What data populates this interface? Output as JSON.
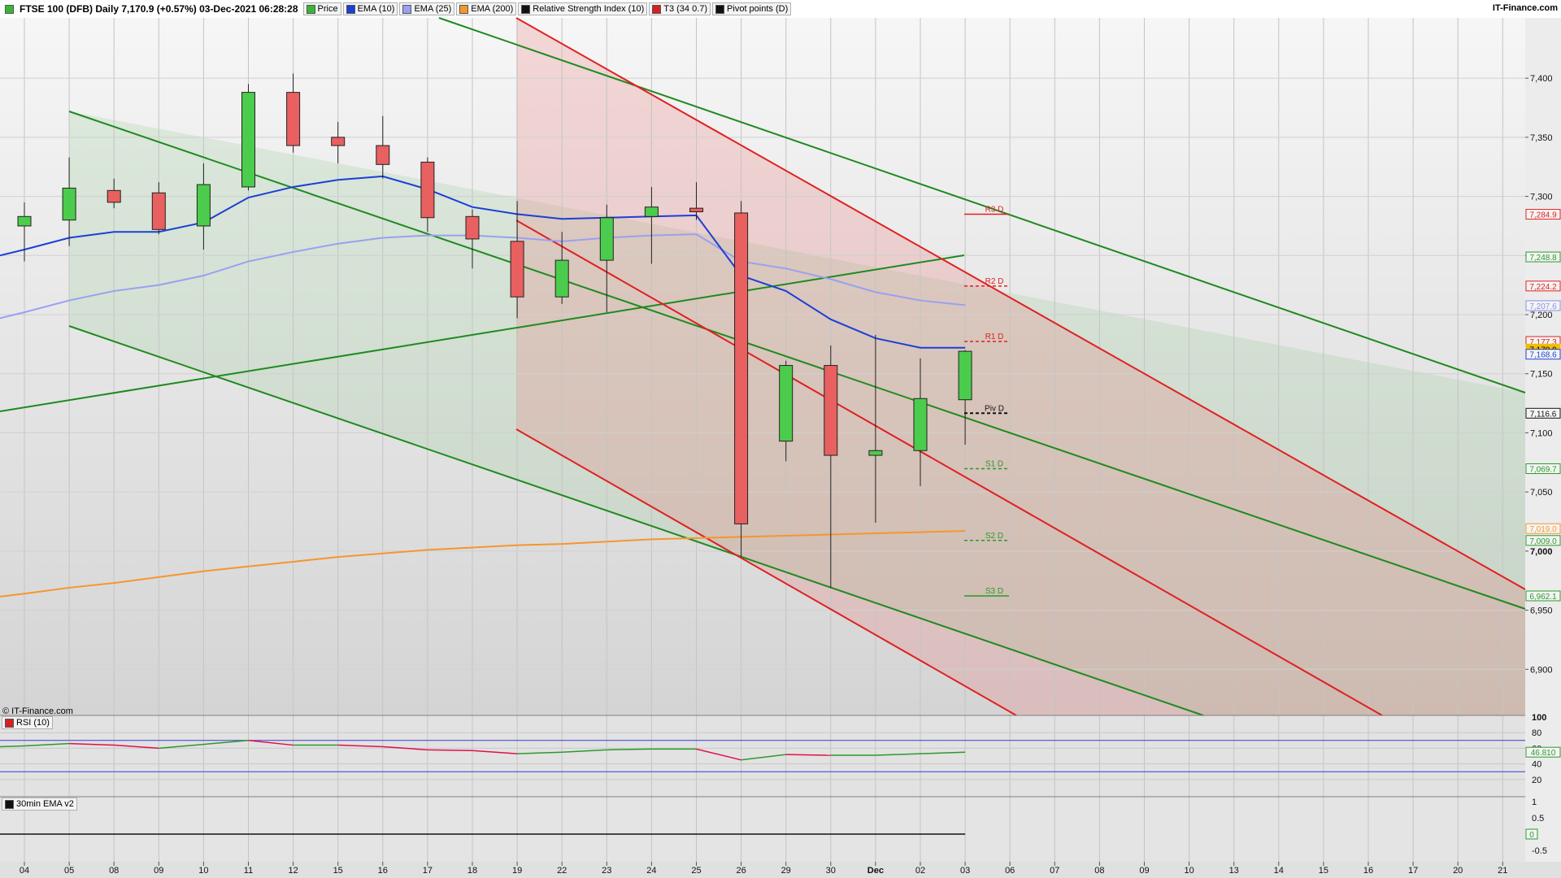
{
  "header": {
    "instrument": "FTSE 100 (DFB) Daily 7,170.9 (+0.57%) 03-Dec-2021 06:28:28",
    "site": "IT-Finance.com",
    "legend": [
      {
        "label": "Price",
        "color": "#3ab53a"
      },
      {
        "label": "EMA (10)",
        "color": "#1c3fd6"
      },
      {
        "label": "EMA (25)",
        "color": "#9aa0f0"
      },
      {
        "label": "EMA (200)",
        "color": "#f5962e"
      },
      {
        "label": "Relative Strength Index (10)",
        "color": "#111111"
      },
      {
        "label": "T3 (34 0.7)",
        "color": "#d62020"
      },
      {
        "label": "Pivot points (D)",
        "color": "#111111"
      }
    ]
  },
  "copyright": "© IT-Finance.com",
  "rsi_panel": {
    "label": "RSI (10)",
    "ticks": [
      "100",
      "80",
      "60",
      "40",
      "20"
    ],
    "current": "46.810"
  },
  "ema_panel": {
    "label": "30min EMA v2",
    "ticks": [
      "1",
      "0.5",
      "0",
      "-0.5"
    ],
    "current": "0"
  },
  "chart_data": {
    "type": "candlestick",
    "title": "FTSE 100 (DFB) Daily",
    "x_labels": [
      "04",
      "05",
      "08",
      "09",
      "10",
      "11",
      "12",
      "15",
      "16",
      "17",
      "18",
      "19",
      "22",
      "23",
      "24",
      "25",
      "26",
      "29",
      "30",
      "Dec",
      "02",
      "03",
      "06",
      "07",
      "08",
      "09",
      "10",
      "13",
      "14",
      "15",
      "16",
      "17",
      "20",
      "21"
    ],
    "y_ticks": [
      6900,
      6950,
      7000,
      7050,
      7100,
      7150,
      7200,
      7250,
      7300,
      7350,
      7400
    ],
    "ylim": [
      6861,
      7451
    ],
    "candles": [
      {
        "x": "04",
        "o": 7275,
        "h": 7295,
        "l": 7245,
        "c": 7283
      },
      {
        "x": "05",
        "o": 7280,
        "h": 7333,
        "l": 7258,
        "c": 7307
      },
      {
        "x": "08",
        "o": 7305,
        "h": 7315,
        "l": 7290,
        "c": 7295
      },
      {
        "x": "09",
        "o": 7303,
        "h": 7312,
        "l": 7268,
        "c": 7272
      },
      {
        "x": "10",
        "o": 7275,
        "h": 7328,
        "l": 7255,
        "c": 7310
      },
      {
        "x": "11",
        "o": 7308,
        "h": 7395,
        "l": 7305,
        "c": 7388
      },
      {
        "x": "12",
        "o": 7388,
        "h": 7404,
        "l": 7337,
        "c": 7343
      },
      {
        "x": "15",
        "o": 7350,
        "h": 7363,
        "l": 7328,
        "c": 7343
      },
      {
        "x": "16",
        "o": 7343,
        "h": 7368,
        "l": 7315,
        "c": 7327
      },
      {
        "x": "17",
        "o": 7329,
        "h": 7333,
        "l": 7270,
        "c": 7282
      },
      {
        "x": "18",
        "o": 7283,
        "h": 7289,
        "l": 7239,
        "c": 7264
      },
      {
        "x": "19",
        "o": 7262,
        "h": 7296,
        "l": 7197,
        "c": 7215
      },
      {
        "x": "22",
        "o": 7215,
        "h": 7270,
        "l": 7209,
        "c": 7246
      },
      {
        "x": "23",
        "o": 7246,
        "h": 7293,
        "l": 7202,
        "c": 7282
      },
      {
        "x": "24",
        "o": 7283,
        "h": 7308,
        "l": 7243,
        "c": 7291
      },
      {
        "x": "25",
        "o": 7290,
        "h": 7312,
        "l": 7280,
        "c": 7287
      },
      {
        "x": "26",
        "o": 7286,
        "h": 7296,
        "l": 6995,
        "c": 7023
      },
      {
        "x": "29",
        "o": 7093,
        "h": 7161,
        "l": 7076,
        "c": 7157
      },
      {
        "x": "30",
        "o": 7157,
        "h": 7174,
        "l": 6969,
        "c": 7081
      },
      {
        "x": "Dec",
        "o": 7081,
        "h": 7183,
        "l": 7024,
        "c": 7085
      },
      {
        "x": "02",
        "o": 7085,
        "h": 7163,
        "l": 7055,
        "c": 7129
      },
      {
        "x": "03",
        "o": 7128,
        "h": 7170,
        "l": 7090,
        "c": 7169
      }
    ],
    "ema10": [
      7255,
      7265,
      7270,
      7270,
      7278,
      7299,
      7308,
      7314,
      7317,
      7306,
      7291,
      7285,
      7281,
      7282,
      7283,
      7284,
      7233,
      7220,
      7196,
      7180,
      7172,
      7172
    ],
    "ema25": [
      7202,
      7212,
      7220,
      7225,
      7233,
      7245,
      7253,
      7260,
      7265,
      7267,
      7267,
      7265,
      7262,
      7265,
      7267,
      7268,
      7245,
      7239,
      7230,
      7219,
      7212,
      7208
    ],
    "ema200": [
      6964,
      6969,
      6973,
      6978,
      6983,
      6987,
      6991,
      6995,
      6998,
      7001,
      7003,
      7005,
      7006,
      7008,
      7010,
      7011,
      7012,
      7013,
      7014,
      7015,
      7016,
      7017
    ],
    "pivots": [
      {
        "label": "R3 D",
        "value": 7284.9,
        "color": "#e02020",
        "dashed": false
      },
      {
        "label": "R2 D",
        "value": 7224.2,
        "color": "#e02020",
        "dashed": true
      },
      {
        "label": "R1 D",
        "value": 7177.3,
        "color": "#e02020",
        "dashed": true
      },
      {
        "label": "Piv D",
        "value": 7116.6,
        "color": "#111111",
        "dashed": true
      },
      {
        "label": "S1 D",
        "value": 7069.7,
        "color": "#2b9a2b",
        "dashed": true
      },
      {
        "label": "S2 D",
        "value": 7009.0,
        "color": "#2b9a2b",
        "dashed": true
      },
      {
        "label": "S3 D",
        "value": 6962.1,
        "color": "#2b9a2b",
        "dashed": false
      }
    ],
    "price_tags": [
      {
        "text": "7,284.9",
        "value": 7284.9,
        "color": "#e02020"
      },
      {
        "text": "7,248.8",
        "value": 7248.8,
        "color": "#2b9a2b"
      },
      {
        "text": "7,224.2",
        "value": 7224.2,
        "color": "#e02020"
      },
      {
        "text": "7,207.6",
        "value": 7207.6,
        "color": "#8890e8"
      },
      {
        "text": "7,177.3",
        "value": 7177.3,
        "color": "#e02020"
      },
      {
        "text": "7,170.9",
        "value": 7170.9,
        "color": "#f0c000"
      },
      {
        "text": "7,168.6",
        "value": 7166.5,
        "color": "#1c3fd6"
      },
      {
        "text": "7,116.6",
        "value": 7116.6,
        "color": "#111111"
      },
      {
        "text": "7,069.7",
        "value": 7069.7,
        "color": "#2b9a2b"
      },
      {
        "text": "7,019.0",
        "value": 7019.0,
        "color": "#f5962e"
      },
      {
        "text": "7,009.0",
        "value": 7009.0,
        "color": "#2b9a2b"
      },
      {
        "text": "6,962.1",
        "value": 6962.1,
        "color": "#2b9a2b"
      }
    ],
    "rsi": [
      63,
      66,
      64,
      60,
      65,
      70,
      64,
      64,
      62,
      58,
      57,
      53,
      55,
      58,
      59,
      59,
      45,
      52,
      51,
      51,
      53,
      55
    ]
  }
}
